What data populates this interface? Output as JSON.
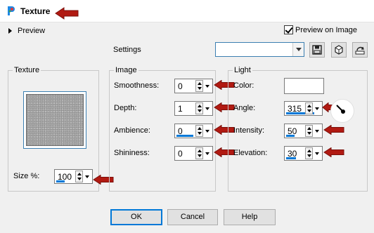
{
  "window": {
    "title": "Texture"
  },
  "preview": {
    "label": "Preview",
    "preview_on_image_label": "Preview on Image",
    "preview_on_image_checked": true
  },
  "settings": {
    "label": "Settings",
    "combo_value": ""
  },
  "texture_group": {
    "title": "Texture",
    "size_label": "Size %:",
    "size_value": "100"
  },
  "image_group": {
    "title": "Image",
    "smoothness_label": "Smoothness:",
    "smoothness_value": "0",
    "depth_label": "Depth:",
    "depth_value": "1",
    "ambience_label": "Ambience:",
    "ambience_value": "0",
    "shininess_label": "Shininess:",
    "shininess_value": "0"
  },
  "light_group": {
    "title": "Light",
    "color_label": "Color:",
    "color_value": "#ffffff",
    "angle_label": "Angle:",
    "angle_value": "315",
    "intensity_label": "Intensity:",
    "intensity_value": "50",
    "elevation_label": "Elevation:",
    "elevation_value": "30"
  },
  "buttons": {
    "ok": "OK",
    "cancel": "Cancel",
    "help": "Help"
  },
  "colors": {
    "accent": "#0078d7",
    "annotation_arrow": "#b11a12"
  },
  "icons": [
    "app-icon",
    "save-preset-icon",
    "load-preset-icon",
    "reset-icon",
    "angle-dial-icon"
  ]
}
